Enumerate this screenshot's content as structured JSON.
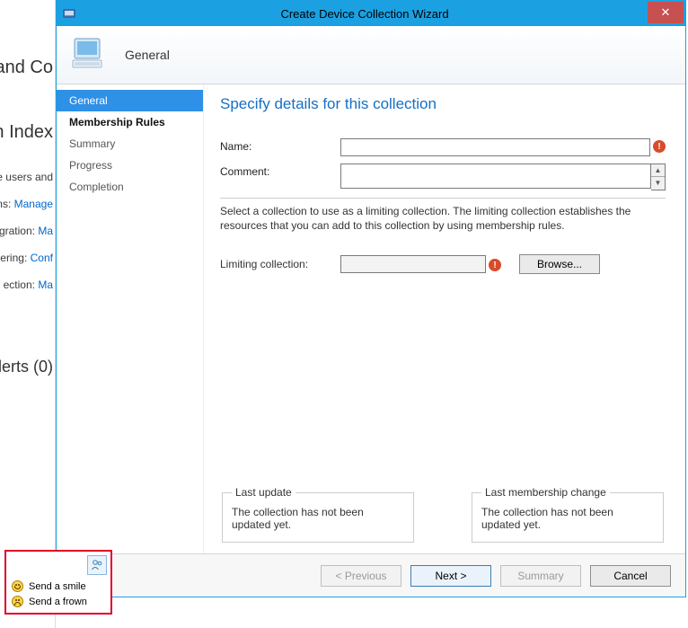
{
  "bg": {
    "title1": "and Co",
    "title2": "n Index",
    "row1": "e users and",
    "row2_pre": "ns:",
    "row2_link": "Manage",
    "row3_pre": "gration:",
    "row3_link": "Ma",
    "row4_pre": "ering:",
    "row4_link": "Conf",
    "row5_pre": "ection:",
    "row5_link": "Ma",
    "alerts": "lerts (0)"
  },
  "wizard": {
    "window_title": "Create Device Collection Wizard",
    "banner_title": "General",
    "steps": {
      "general": "General",
      "membership": "Membership Rules",
      "summary": "Summary",
      "progress": "Progress",
      "completion": "Completion"
    },
    "heading": "Specify details for this collection",
    "labels": {
      "name": "Name:",
      "comment": "Comment:",
      "limiting": "Limiting collection:"
    },
    "values": {
      "name": "",
      "comment": "",
      "limiting": ""
    },
    "help": "Select a collection to use as a limiting collection. The limiting collection establishes the resources that you can add to this collection by using membership rules.",
    "browse": "Browse...",
    "groupboxes": {
      "last_update_title": "Last update",
      "last_update_text": "The collection has not been updated yet.",
      "last_membership_title": "Last membership change",
      "last_membership_text": "The collection has not been updated yet."
    },
    "buttons": {
      "previous": "< Previous",
      "next": "Next >",
      "summary": "Summary",
      "cancel": "Cancel"
    }
  },
  "feedback": {
    "smile": "Send a smile",
    "frown": "Send a frown"
  }
}
